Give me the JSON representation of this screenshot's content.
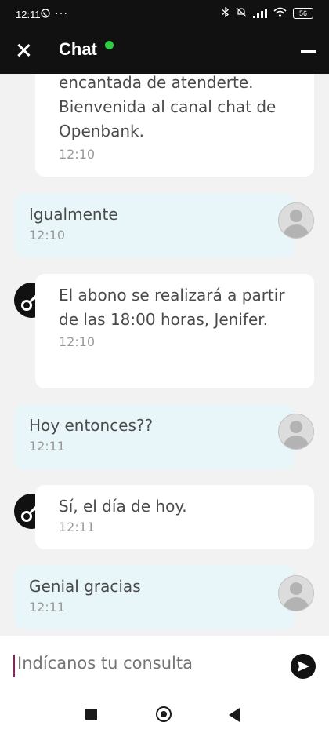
{
  "status_bar": {
    "time": "12:11",
    "battery": "56",
    "dots": "···"
  },
  "header": {
    "title": "Chat",
    "online_color": "#2ecc40"
  },
  "messages": [
    {
      "sender": "agent",
      "text": "encantada de atenderte. Bienvenida al canal chat de Openbank.",
      "time": "12:10"
    },
    {
      "sender": "user",
      "text": "Igualmente",
      "time": "12:10"
    },
    {
      "sender": "agent",
      "text": "El abono se realizará a partir de las 18:00 horas, Jenifer.",
      "time": "12:10"
    },
    {
      "sender": "user",
      "text": "Hoy entonces??",
      "time": "12:11"
    },
    {
      "sender": "agent",
      "text": "Sí, el día de hoy.",
      "time": "12:11"
    },
    {
      "sender": "user",
      "text": "Genial gracias",
      "time": "12:11"
    }
  ],
  "composer": {
    "placeholder": "Indícanos tu consulta"
  },
  "colors": {
    "header_bg": "#111111",
    "user_bubble": "#e8f6fa",
    "agent_bubble": "#ffffff",
    "caret": "#a0165a"
  }
}
